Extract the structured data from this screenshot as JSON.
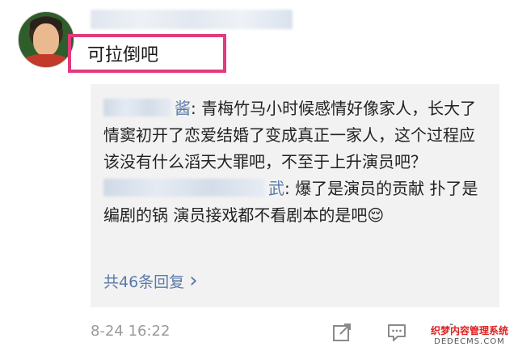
{
  "comment": {
    "text": "可拉倒吧",
    "date": "8-24 16:22"
  },
  "replies": [
    {
      "author_tail": "酱",
      "text": ": 青梅竹马小时候感情好像家人，长大了情窦初开了恋爱结婚了变成真正一家人，这个过程应该没有什么滔天大罪吧，不至于上升演员吧？"
    },
    {
      "author_tail": "武",
      "text": ": 爆了是演员的贡献 扑了是编剧的锅 演员接戏都不看剧本的是吧😌"
    }
  ],
  "more_replies_label": "共46条回复",
  "more_replies_chevron": "›",
  "icons": [
    "share-icon",
    "comment-icon",
    "like-icon"
  ],
  "watermark": {
    "line1": "织梦内容管理系统",
    "line2": "DEDECMS.COM"
  },
  "colors": {
    "highlight_border": "#e23a7d",
    "link": "#5b7aa8",
    "reply_background": "#f2f2f2"
  }
}
